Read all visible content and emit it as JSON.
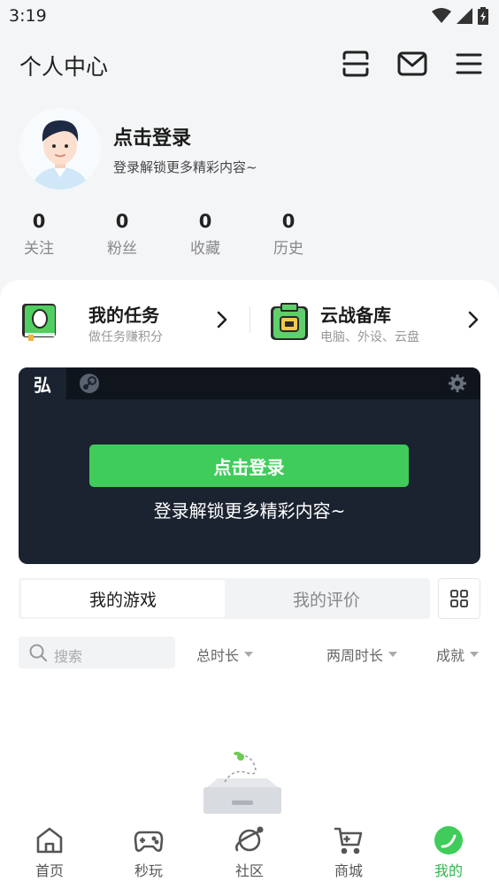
{
  "status_bar": {
    "time": "3:19"
  },
  "header": {
    "title": "个人中心"
  },
  "profile": {
    "login_title": "点击登录",
    "login_subtitle": "登录解锁更多精彩内容~"
  },
  "stats": [
    {
      "value": "0",
      "label": "关注"
    },
    {
      "value": "0",
      "label": "粉丝"
    },
    {
      "value": "0",
      "label": "收藏"
    },
    {
      "value": "0",
      "label": "历史"
    }
  ],
  "quick_links": [
    {
      "title": "我的任务",
      "subtitle": "做任务赚积分",
      "icon": "task-book-icon"
    },
    {
      "title": "云战备库",
      "subtitle": "电脑、外设、云盘",
      "icon": "backpack-icon"
    }
  ],
  "steam_panel": {
    "tab_label": "弘",
    "login_button": "点击登录",
    "subtitle": "登录解锁更多精彩内容~"
  },
  "tabs": [
    {
      "label": "我的游戏",
      "active": true
    },
    {
      "label": "我的评价",
      "active": false
    }
  ],
  "search": {
    "placeholder": "搜索"
  },
  "filters": [
    {
      "label": "总时长"
    },
    {
      "label": "两周时长"
    },
    {
      "label": "成就"
    }
  ],
  "bottom_nav": [
    {
      "label": "首页",
      "icon": "home-icon",
      "active": false
    },
    {
      "label": "秒玩",
      "icon": "gamepad-icon",
      "active": false
    },
    {
      "label": "社区",
      "icon": "planet-icon",
      "active": false
    },
    {
      "label": "商城",
      "icon": "cart-icon",
      "active": false
    },
    {
      "label": "我的",
      "icon": "profile-leaf-icon",
      "active": true
    }
  ],
  "colors": {
    "accent": "#3fcc5a",
    "steam_bg": "#1b2230",
    "page_bg": "#f4f5f7"
  }
}
